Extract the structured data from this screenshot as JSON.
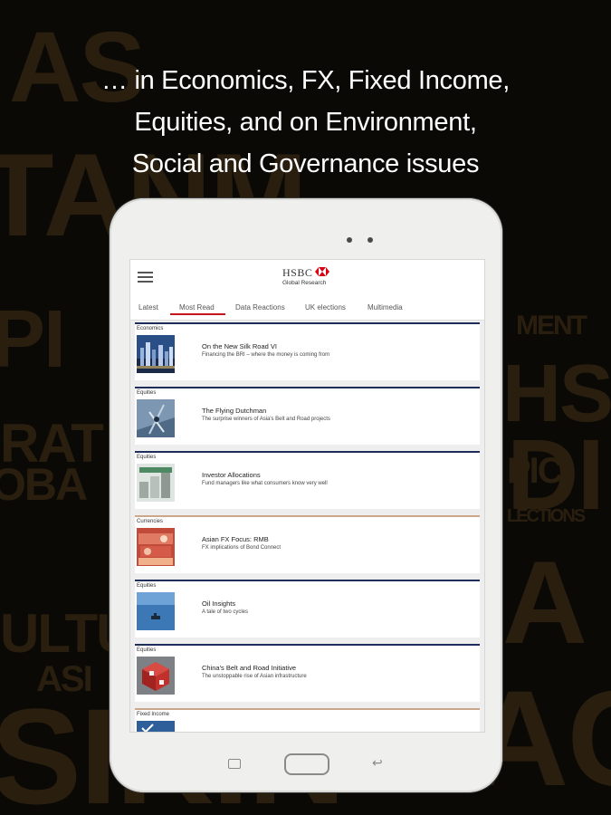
{
  "headline": {
    "lines": [
      "… in Economics, FX, Fixed Income,",
      "Equities, and on Environment,",
      "Social and Governance issues"
    ]
  },
  "background_words": [
    "AS",
    "TANM",
    "PI",
    "RAT",
    "OBA",
    "ULTU",
    "ASI",
    "SIKIN",
    "MENT",
    "HS",
    "DI",
    "PIC",
    "LECTIONS",
    "AC",
    "A"
  ],
  "app": {
    "logo": {
      "name": "HSBC",
      "subtitle": "Global Research",
      "mark_color": "#db0011"
    },
    "tabs": [
      "Latest",
      "Most Read",
      "Data Reactions",
      "UK elections",
      "Multimedia"
    ],
    "active_tab": "Most Read",
    "accent_color": "#c4161c",
    "cards": [
      {
        "category": "Economics",
        "title": "On the New Silk Road VI",
        "subtitle": "Financing the BRI – where the money is coming from",
        "thumb_icon": "city-skyline-image"
      },
      {
        "category": "Equities",
        "title": "The Flying Dutchman",
        "subtitle": "The surprise winners of Asia's Belt and Road projects",
        "thumb_icon": "windmill-image"
      },
      {
        "category": "Equities",
        "title": "Investor Allocations",
        "subtitle": "Fund managers like what consumers know very well",
        "thumb_icon": "stacked-coins-image"
      },
      {
        "category": "Currencies",
        "title": "Asian FX Focus: RMB",
        "subtitle": "FX implications of Bond Connect",
        "thumb_icon": "banknotes-image"
      },
      {
        "category": "Equities",
        "title": "Oil Insights",
        "subtitle": "A tale of two cycles",
        "thumb_icon": "ocean-tanker-image"
      },
      {
        "category": "Equities",
        "title": "China's Belt and Road Initiative",
        "subtitle": "The unstoppable rise of Asian infrastructure",
        "thumb_icon": "red-cube-image"
      },
      {
        "category": "Fixed Income",
        "title": "",
        "subtitle": "",
        "thumb_icon": "checkmark-image"
      }
    ]
  }
}
